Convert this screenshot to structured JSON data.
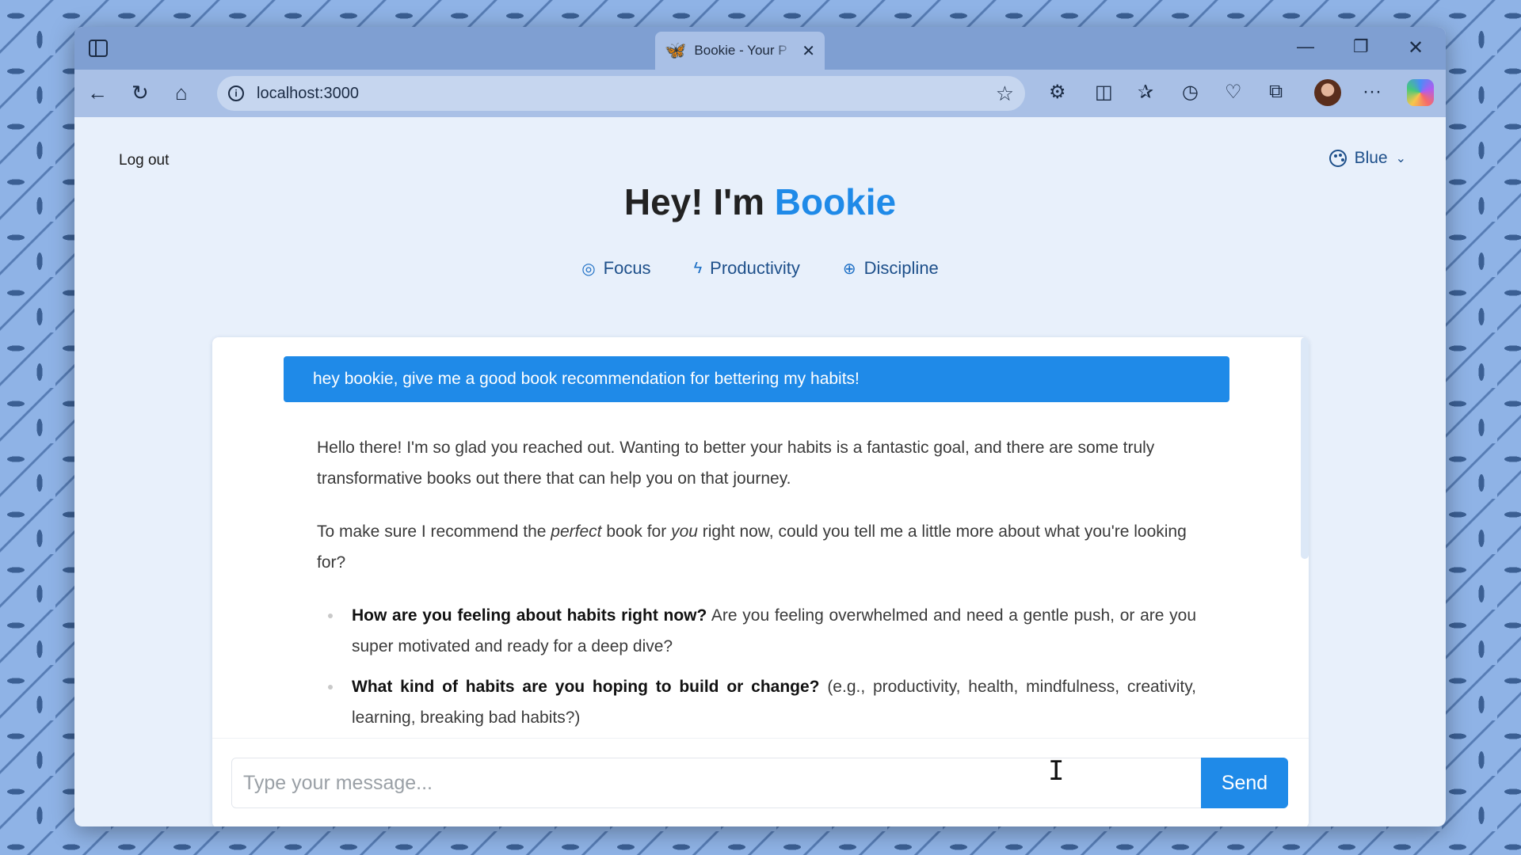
{
  "browser": {
    "tab_title": "Bookie - Your P",
    "tab_icon": "butterfly-icon",
    "url": "localhost:3000"
  },
  "header": {
    "logout_label": "Log out",
    "theme_label": "Blue",
    "title_prefix": "Hey! I'm ",
    "title_brand": "Bookie",
    "tags": [
      {
        "icon": "target-icon",
        "label": "Focus"
      },
      {
        "icon": "bolt-icon",
        "label": "Productivity"
      },
      {
        "icon": "brain-icon",
        "label": "Discipline"
      }
    ]
  },
  "chat": {
    "user_message": "hey bookie, give me a good book recommendation for bettering my habits!",
    "bot": {
      "para1": "Hello there! I'm so glad you reached out. Wanting to better your habits is a fantastic goal, and there are some truly transformative books out there that can help you on that journey.",
      "para2_a": "To make sure I recommend the ",
      "para2_em1": "perfect",
      "para2_b": " book for ",
      "para2_em2": "you",
      "para2_c": " right now, could you tell me a little more about what you're looking for?",
      "bullets": [
        {
          "bold": "How are you feeling about habits right now?",
          "text": " Are you feeling overwhelmed and need a gentle push, or are you super motivated and ready for a deep dive?"
        },
        {
          "bold": "What kind of habits are you hoping to build or change?",
          "text": " (e.g., productivity, health, mindfulness, creativity, learning, breaking bad habits?)"
        }
      ]
    },
    "input_placeholder": "Type your message...",
    "send_label": "Send"
  },
  "colors": {
    "accent": "#1f8ae8",
    "tag_text": "#1d4f8a"
  }
}
